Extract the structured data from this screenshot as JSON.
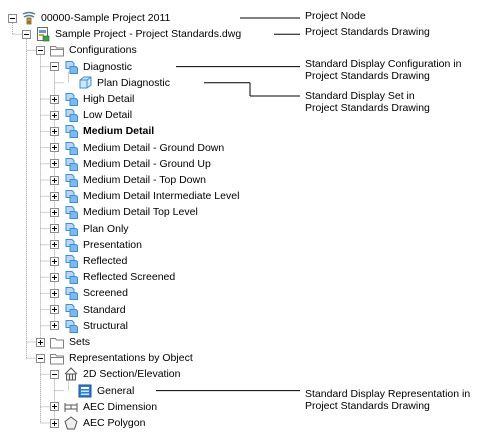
{
  "tree": [
    {
      "label": "00000-Sample Project 2011",
      "icon": "project-node-icon",
      "toggle": "minus",
      "bold": false
    },
    {
      "label": "Sample Project - Project Standards.dwg",
      "icon": "drawing-file-icon",
      "toggle": "minus",
      "bold": false
    },
    {
      "label": "Configurations",
      "icon": "folder-open-icon",
      "toggle": "minus",
      "bold": false
    },
    {
      "label": "Diagnostic",
      "icon": "display-configuration-icon",
      "toggle": "minus",
      "bold": false
    },
    {
      "label": "Plan Diagnostic",
      "icon": "display-set-icon",
      "toggle": "none",
      "bold": false
    },
    {
      "label": "High Detail",
      "icon": "display-configuration-icon",
      "toggle": "plus",
      "bold": false
    },
    {
      "label": "Low Detail",
      "icon": "display-configuration-icon",
      "toggle": "plus",
      "bold": false
    },
    {
      "label": "Medium Detail",
      "icon": "display-configuration-icon",
      "toggle": "plus",
      "bold": true
    },
    {
      "label": "Medium Detail - Ground Down",
      "icon": "display-configuration-icon",
      "toggle": "plus",
      "bold": false
    },
    {
      "label": "Medium Detail - Ground Up",
      "icon": "display-configuration-icon",
      "toggle": "plus",
      "bold": false
    },
    {
      "label": "Medium Detail - Top Down",
      "icon": "display-configuration-icon",
      "toggle": "plus",
      "bold": false
    },
    {
      "label": "Medium Detail Intermediate Level",
      "icon": "display-configuration-icon",
      "toggle": "plus",
      "bold": false
    },
    {
      "label": "Medium Detail Top Level",
      "icon": "display-configuration-icon",
      "toggle": "plus",
      "bold": false
    },
    {
      "label": "Plan Only",
      "icon": "display-configuration-icon",
      "toggle": "plus",
      "bold": false
    },
    {
      "label": "Presentation",
      "icon": "display-configuration-icon",
      "toggle": "plus",
      "bold": false
    },
    {
      "label": "Reflected",
      "icon": "display-configuration-icon",
      "toggle": "plus",
      "bold": false
    },
    {
      "label": "Reflected Screened",
      "icon": "display-configuration-icon",
      "toggle": "plus",
      "bold": false
    },
    {
      "label": "Screened",
      "icon": "display-configuration-icon",
      "toggle": "plus",
      "bold": false
    },
    {
      "label": "Standard",
      "icon": "display-configuration-icon",
      "toggle": "plus",
      "bold": false
    },
    {
      "label": "Structural",
      "icon": "display-configuration-icon",
      "toggle": "plus",
      "bold": false
    },
    {
      "label": "Sets",
      "icon": "folder-closed-icon",
      "toggle": "plus",
      "bold": false
    },
    {
      "label": "Representations by Object",
      "icon": "folder-open-icon",
      "toggle": "minus",
      "bold": false
    },
    {
      "label": "2D Section/Elevation",
      "icon": "section-elevation-icon",
      "toggle": "minus",
      "bold": false
    },
    {
      "label": "General",
      "icon": "display-representation-icon",
      "toggle": "none",
      "bold": false
    },
    {
      "label": "AEC Dimension",
      "icon": "aec-dimension-icon",
      "toggle": "plus",
      "bold": false
    },
    {
      "label": "AEC Polygon",
      "icon": "aec-polygon-icon",
      "toggle": "plus",
      "bold": false
    }
  ],
  "callouts": {
    "project_node": "Project Node",
    "project_standards_drawing": "Project Standards Drawing",
    "display_configuration": [
      "Standard Display Configuration in",
      "Project Standards Drawing"
    ],
    "display_set": [
      "Standard Display Set in",
      "Project Standards Drawing"
    ],
    "display_representation": [
      "Standard Display Representation in",
      "Project Standards Drawing"
    ]
  },
  "colors": {
    "tree_line": "#a0a0a0",
    "callout_line": "#000000",
    "toggle_border": "#8c8c8c",
    "config_icon_blue": "#3a8fd8",
    "folder_outline": "#808080"
  }
}
